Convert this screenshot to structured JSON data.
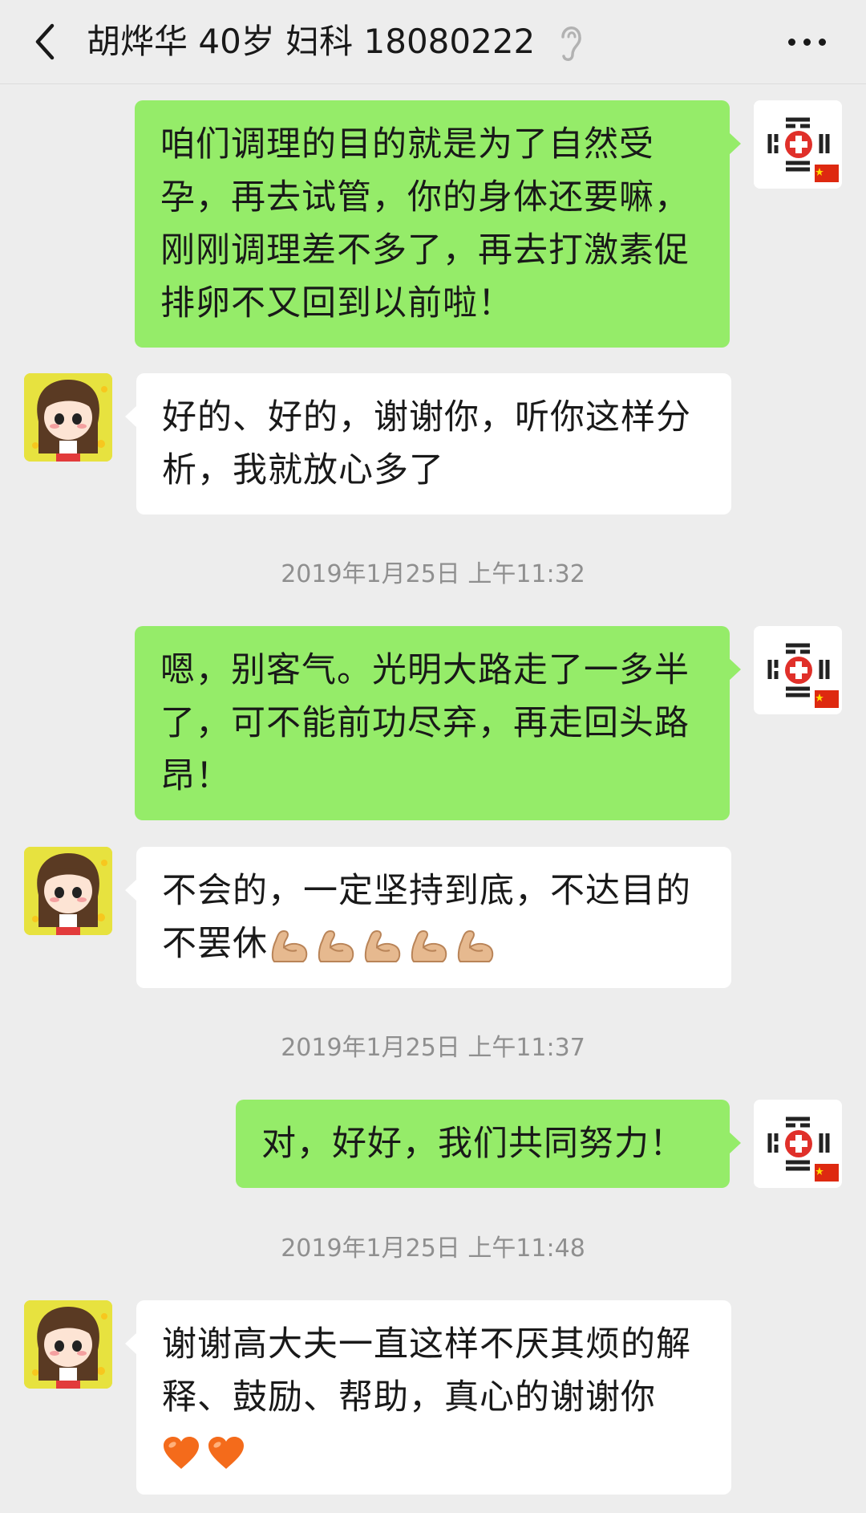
{
  "header": {
    "back_icon": "chevron-left-icon",
    "title": "胡烨华 40岁 妇科 18080222",
    "ear_icon": "earpiece-mode-icon",
    "more_icon": "more-dots-icon"
  },
  "colors": {
    "sent_bubble": "#95ec69",
    "received_bubble": "#ffffff",
    "background": "#ededed",
    "timestamp_text": "#8f8f8f"
  },
  "messages": [
    {
      "direction": "sent",
      "lines": [
        "咱们调理的目的就是为了自然受",
        "孕，再去试管，你的身体还要嘛，",
        "刚刚调理差不多了，再去打激素促",
        "排卵不又回到以前啦！"
      ]
    },
    {
      "direction": "received",
      "lines": [
        "好的、好的，谢谢你，听你这样分",
        "析，我就放心多了"
      ]
    },
    {
      "direction": "sent",
      "lines": [
        "嗯，别客气。光明大路走了一多半",
        "了，可不能前功尽弃，再走回头路",
        "昂！"
      ]
    },
    {
      "direction": "received",
      "lines": [
        "不会的，一定坚持到底，不达目的",
        "不罢休"
      ],
      "emoji": "flexed-biceps",
      "emoji_count": 5
    },
    {
      "direction": "sent",
      "lines": [
        "对，好好，我们共同努力！"
      ]
    },
    {
      "direction": "received",
      "lines": [
        "谢谢高大夫一直这样不厌其烦的解",
        "释、鼓励、帮助，真心的谢谢你"
      ],
      "emoji": "orange-heart",
      "emoji_count": 2
    }
  ],
  "timestamps": [
    "2019年1月25日 上午11:32",
    "2019年1月25日 上午11:37",
    "2019年1月25日 上午11:48"
  ]
}
